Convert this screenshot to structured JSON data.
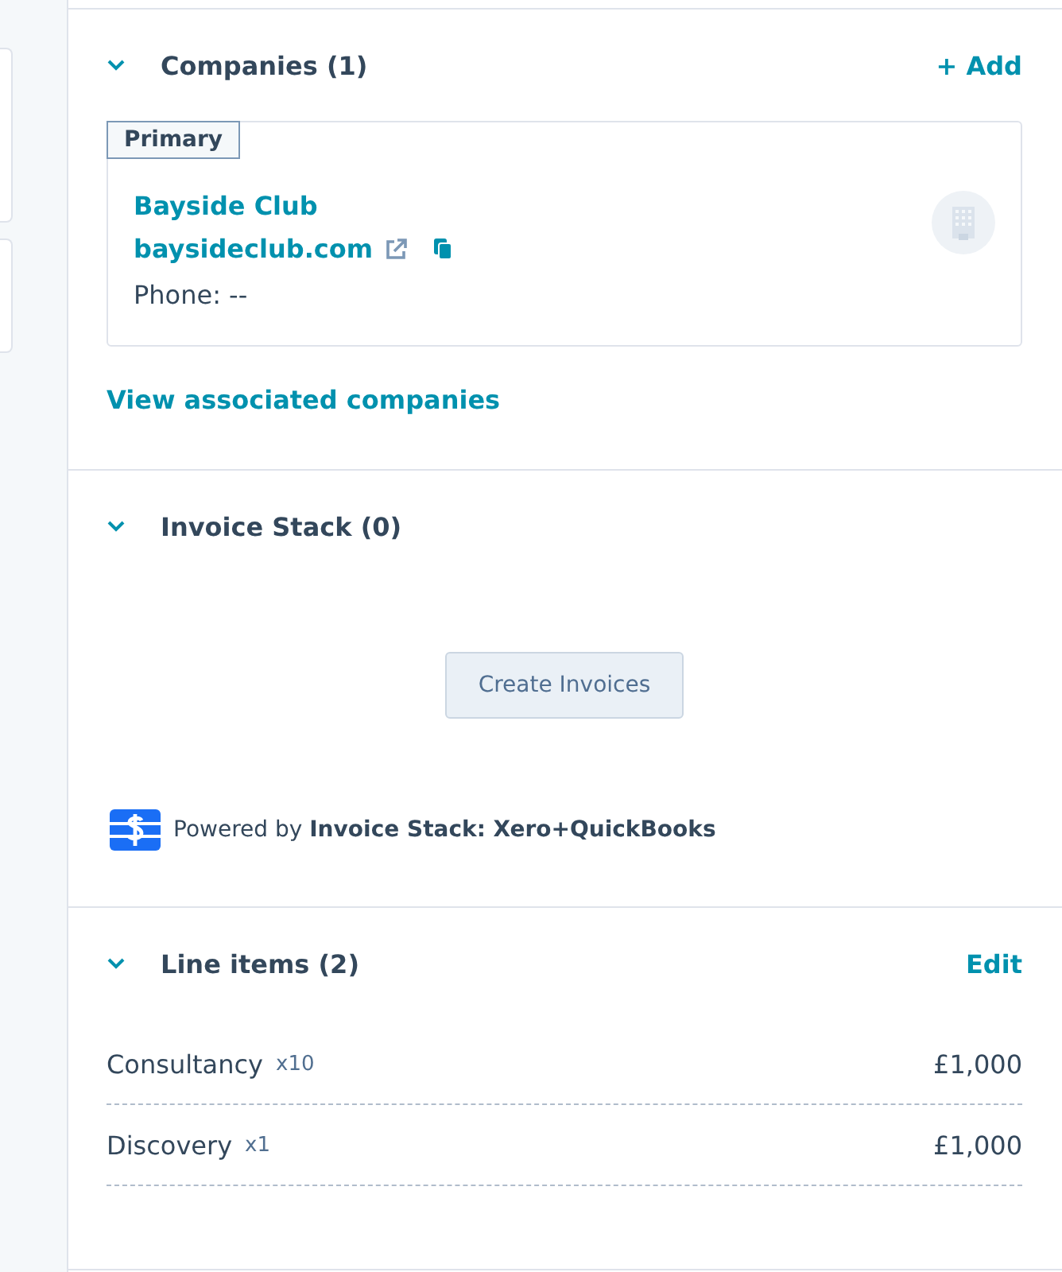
{
  "companies": {
    "title": "Companies (1)",
    "expanded": true,
    "action": "+ Add",
    "card": {
      "tag": "Primary",
      "name": "Bayside Club",
      "domain": "baysideclub.com",
      "phone": "Phone: --"
    },
    "link": "View associated companies"
  },
  "invoice_stack": {
    "title": "Invoice Stack (0)",
    "expanded": true,
    "button": "Create Invoices",
    "powered_prefix": "Powered by",
    "powered_name": "Invoice Stack: Xero+QuickBooks"
  },
  "line_items": {
    "title": "Line items (2)",
    "expanded": true,
    "action": "Edit",
    "rows": [
      {
        "name": "Consultancy",
        "quantity": "x10",
        "price": "£1,000"
      },
      {
        "name": "Discovery",
        "quantity": "x1",
        "price": "£1,000"
      }
    ]
  }
}
